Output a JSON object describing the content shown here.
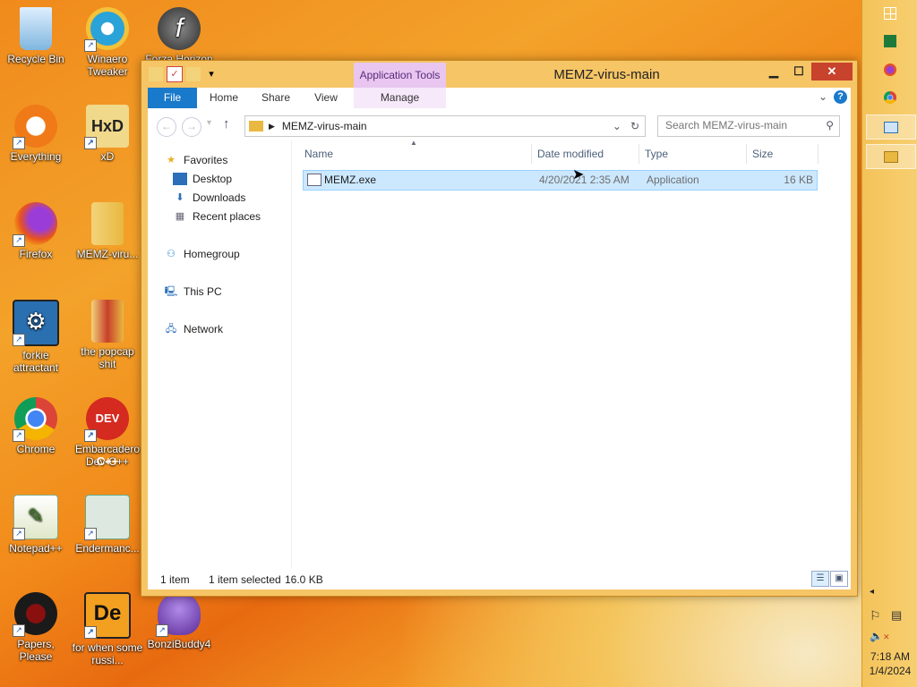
{
  "desktop": {
    "icons": [
      {
        "label": "Recycle Bin",
        "icon": "recycle-bin-icon",
        "color": "#7fb6df"
      },
      {
        "label": "Winaero Tweaker",
        "icon": "winaero-icon",
        "color": "#2aa3d8"
      },
      {
        "label": "Forza Horizon",
        "icon": "flash-icon",
        "color": "#4a4a4a"
      },
      {
        "label": "Everything",
        "icon": "everything-icon",
        "color": "#f07a18"
      },
      {
        "label": "xD",
        "icon": "hxd-icon",
        "color": "#f0d98a"
      },
      {
        "label": "Firefox",
        "icon": "firefox-icon",
        "color": "#e8521c"
      },
      {
        "label": "MEMZ-viru...",
        "icon": "folder-icon",
        "color": "#f3d37a"
      },
      {
        "label": "forkie attractant",
        "icon": "settings-monitor-icon",
        "color": "#2a6fb0"
      },
      {
        "label": "the popcap shit",
        "icon": "folder-icon",
        "color": "#f3d37a"
      },
      {
        "label": "Chrome",
        "icon": "chrome-icon",
        "color": "#4a9c4a"
      },
      {
        "label": "Embarcadero Dev-C++",
        "icon": "devcpp-icon",
        "color": "#d42a20"
      },
      {
        "label": "Notepad++",
        "icon": "notepadpp-icon",
        "color": "#7ab648"
      },
      {
        "label": "Endermanc...",
        "icon": "document-icon",
        "color": "#dce8e0"
      },
      {
        "label": "Papers, Please",
        "icon": "papers-please-icon",
        "color": "#1a1a1a"
      },
      {
        "label": "for when some russi...",
        "icon": "de-icon",
        "color": "#f3a020"
      },
      {
        "label": "BonziBuddy4",
        "icon": "bonzi-icon",
        "color": "#7a4ab8"
      }
    ]
  },
  "taskbar": {
    "items": [
      "windows-start-icon",
      "excel-icon",
      "firefox-icon",
      "chrome-icon",
      "app-icon",
      "explorer-icon"
    ],
    "time": "7:18 AM",
    "date": "1/4/2024"
  },
  "window": {
    "title": "MEMZ-virus-main",
    "context_tab": "Application Tools",
    "ribbon_tabs": [
      "File",
      "Home",
      "Share",
      "View",
      "Manage"
    ],
    "address": "MEMZ-virus-main",
    "search_placeholder": "Search MEMZ-virus-main",
    "nav": {
      "favorites": "Favorites",
      "favorite_items": [
        "Desktop",
        "Downloads",
        "Recent places"
      ],
      "homegroup": "Homegroup",
      "this_pc": "This PC",
      "network": "Network"
    },
    "columns": [
      "Name",
      "Date modified",
      "Type",
      "Size"
    ],
    "files": [
      {
        "name": "MEMZ.exe",
        "date": "4/20/2021 2:35 AM",
        "type": "Application",
        "size": "16 KB"
      }
    ],
    "status": {
      "count": "1 item",
      "selected": "1 item selected",
      "size": "16.0 KB"
    }
  },
  "colors": {
    "accent": "#1979ca",
    "selection": "#cce8ff",
    "close": "#c8432c",
    "context_tab": "#e8c6f0"
  }
}
